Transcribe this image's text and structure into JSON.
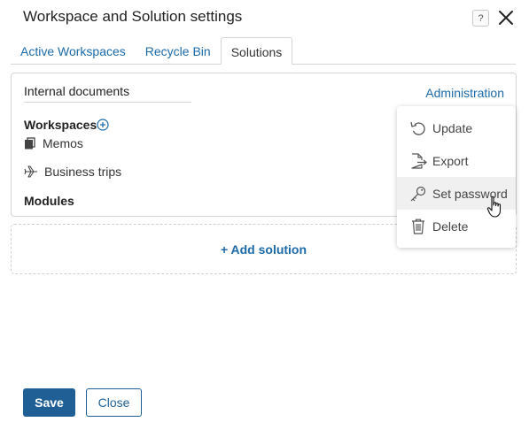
{
  "dialog": {
    "title": "Workspace and Solution settings",
    "help_symbol": "?"
  },
  "tabs": [
    {
      "label": "Active Workspaces",
      "active": false
    },
    {
      "label": "Recycle Bin",
      "active": false
    },
    {
      "label": "Solutions",
      "active": true
    }
  ],
  "solution": {
    "name": "Internal documents",
    "admin_link": "Administration",
    "workspaces_label": "Workspaces",
    "workspaces": [
      {
        "label": "Memos",
        "icon": "documents-icon"
      },
      {
        "label": "Business trips",
        "icon": "airplane-icon"
      }
    ],
    "modules_label": "Modules"
  },
  "add_solution_label": "+ Add solution",
  "menu": {
    "items": [
      {
        "label": "Update",
        "icon": "undo-icon"
      },
      {
        "label": "Export",
        "icon": "export-icon"
      },
      {
        "label": "Set password",
        "icon": "key-icon",
        "hovered": true
      },
      {
        "label": "Delete",
        "icon": "trash-icon"
      }
    ]
  },
  "footer": {
    "save_label": "Save",
    "close_label": "Close"
  },
  "colors": {
    "link": "#1c6aa8",
    "primary": "#1f5f95",
    "border": "#d5d5d5"
  }
}
